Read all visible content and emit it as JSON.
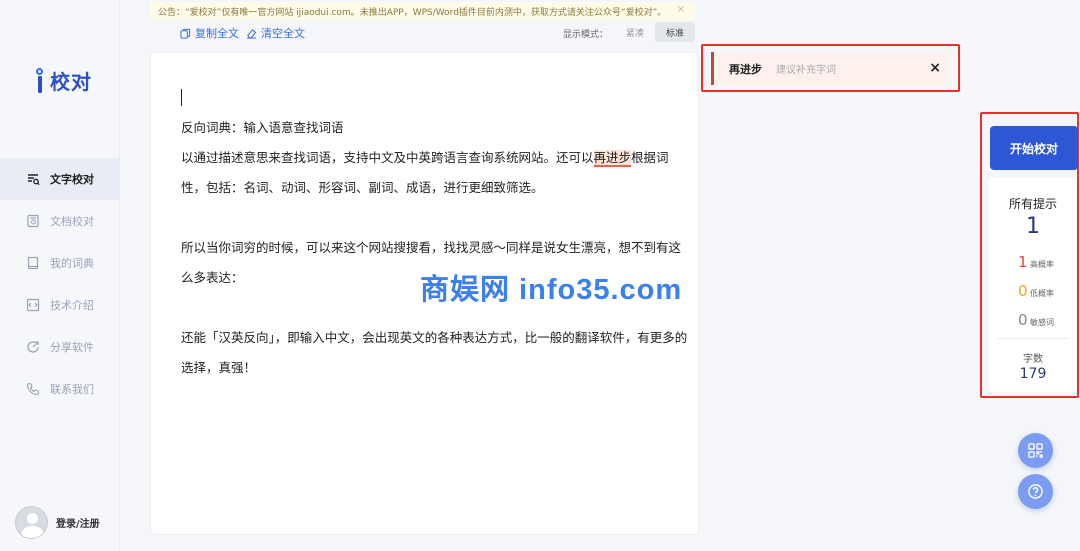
{
  "notice": {
    "text": "公告：“爱校对”仅有唯一官方网站 ijiaodui.com。未推出APP，WPS/Word插件目前内测中，获取方式请关注公众号“爱校对”。",
    "close": "×"
  },
  "logo": {
    "text": "校对"
  },
  "nav": {
    "items": [
      {
        "label": "文字校对",
        "icon": "text-proofread-icon"
      },
      {
        "label": "文档校对",
        "icon": "document-proofread-icon"
      },
      {
        "label": "我的词典",
        "icon": "dictionary-icon"
      },
      {
        "label": "技术介绍",
        "icon": "tech-icon"
      },
      {
        "label": "分享软件",
        "icon": "share-icon"
      },
      {
        "label": "联系我们",
        "icon": "phone-icon"
      }
    ]
  },
  "user": {
    "login_label": "登录/注册"
  },
  "toolbar": {
    "copy_all": "复制全文",
    "clear_all": "清空全文",
    "mode_label": "显示模式：",
    "mode_compact": "紧凑",
    "mode_standard": "标准"
  },
  "editor": {
    "p1": "反向词典：输入语意查找词语",
    "p2_before": "以通过描述意思来查找词语，支持中文及中英跨语言查询系统网站。还可以",
    "p2_highlight": "再进步",
    "p2_after": "根据词性，包括：名词、动词、形容词、副词、成语，进行更细致筛选。",
    "p3": "所以当你词穷的时候，可以来这个网站搜搜看，找找灵感～同样是说女生漂亮，想不到有这么多表达：",
    "p4": "还能「汉英反向」，即输入中文，会出现英文的各种表达方式，比一般的翻译软件，有更多的选择，真强！"
  },
  "suggestion": {
    "word": "再进步",
    "hint": "建议补充字词",
    "close": "×"
  },
  "panel": {
    "start_button": "开始校对",
    "all_hints_label": "所有提示",
    "all_hints_count": "1",
    "high": {
      "count": "1",
      "label": "高概率",
      "color": "#e0443e"
    },
    "low": {
      "count": "0",
      "label": "低概率",
      "color": "#e6a817"
    },
    "sensitive": {
      "count": "0",
      "label": "敏感词",
      "color": "#888888"
    },
    "word_count_label": "字数",
    "word_count": "179"
  },
  "watermark": "商娱网 info35.com",
  "colors": {
    "accent": "#2c58d6",
    "highlight_border": "#e8302d"
  }
}
